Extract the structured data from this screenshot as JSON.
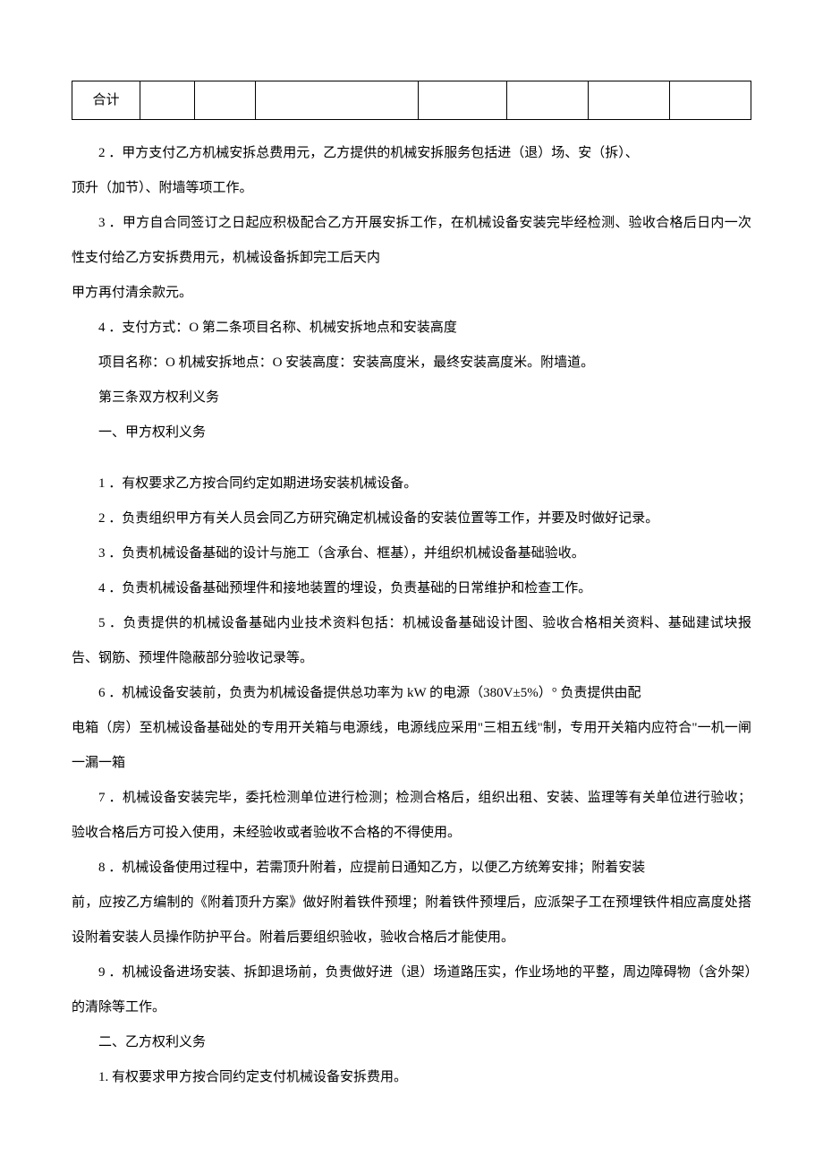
{
  "table": {
    "row_label": "合计"
  },
  "para": {
    "p2": "2 ．甲方支付乙方机械安拆总费用元，乙方提供的机械安拆服务包括进（退）场、安（拆）、",
    "p2b": "顶升（加节）、附墙等项工作。",
    "p3": "3 ．甲方自合同签订之日起应积极配合乙方开展安拆工作，在机械设备安装完毕经检测、验收合格后日内一次性支付给乙方安拆费用元，机械设备拆卸完工后天内",
    "p3b": "甲方再付清余款元。",
    "p4": "4 ．支付方式：O 第二条项目名称、机械安拆地点和安装高度",
    "p4b": "项目名称：O 机械安拆地点：O 安装高度：安装高度米，最终安装高度米。附墙道。",
    "p5": "第三条双方权利义务",
    "p6": "一、甲方权利义务",
    "p7": "1 ．有权要求乙方按合同约定如期进场安装机械设备。",
    "p8": "2 ．负责组织甲方有关人员会同乙方研究确定机械设备的安装位置等工作，并要及时做好记录。",
    "p9": "3 ．负责机械设备基础的设计与施工（含承台、框基），并组织机械设备基础验收。",
    "p10": "4 ．负责机械设备基础预埋件和接地装置的埋设，负责基础的日常维护和检查工作。",
    "p11": "5 ．负责提供的机械设备基础内业技术资料包括：机械设备基础设计图、验收合格相关资料、基础建试块报告、钢筋、预埋件隐蔽部分验收记录等。",
    "p12": "6 ．机械设备安装前，负责为机械设备提供总功率为 kW 的电源（380V±5%）° 负责提供由配",
    "p12b": "电箱（房）至机械设备基础处的专用开关箱与电源线，电源线应采用\"三相五线\"制，专用开关箱内应符合\"一机一闸一漏一箱",
    "p13": "7 ．机械设备安装完毕，委托检测单位进行检测；检测合格后，组织出租、安装、监理等有关单位进行验收；验收合格后方可投入使用，未经验收或者验收不合格的不得使用。",
    "p14": "8 ．机械设备使用过程中，若需顶升附着，应提前日通知乙方，以便乙方统筹安排；附着安装",
    "p14b": "前，应按乙方编制的《附着顶升方案》做好附着铁件预埋；附着铁件预埋后，应派架子工在预埋铁件相应高度处搭设附着安装人员操作防护平台。附着后要组织验收，验收合格后才能使用。",
    "p15": "9 ．机械设备进场安装、拆卸退场前，负责做好进（退）场道路压实，作业场地的平整，周边障碍物（含外架）的清除等工作。",
    "p16": "二、乙方权利义务",
    "p17": "1. 有权要求甲方按合同约定支付机械设备安拆费用。"
  }
}
